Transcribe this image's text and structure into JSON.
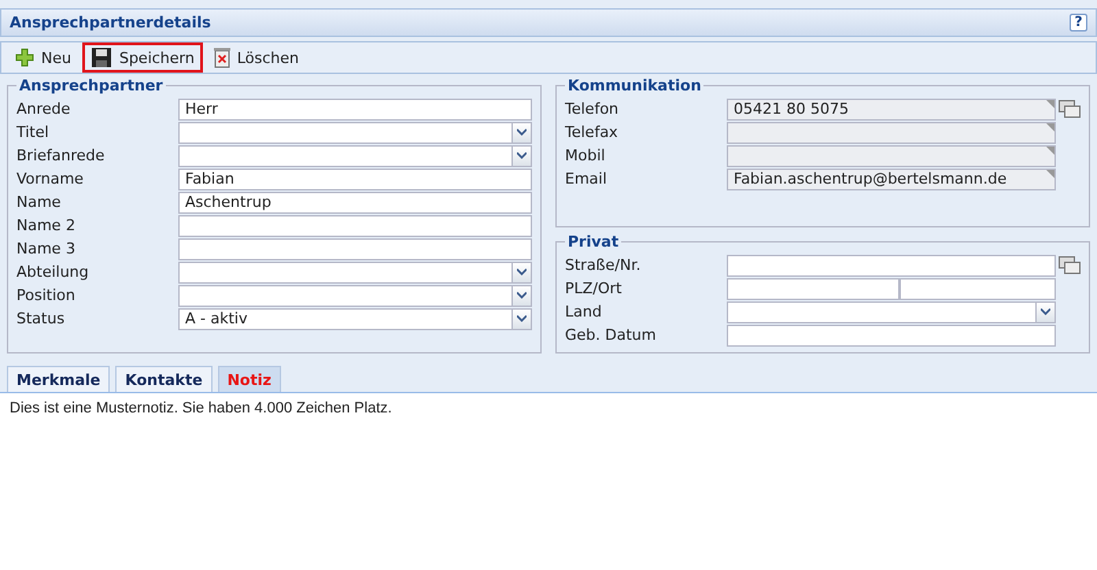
{
  "panel": {
    "title": "Ansprechpartnerdetails",
    "help": "?"
  },
  "toolbar": [
    {
      "kind": "add",
      "label": "Neu",
      "highlighted": false
    },
    {
      "kind": "save",
      "label": "Speichern",
      "highlighted": true
    },
    {
      "kind": "delete",
      "label": "Löschen",
      "highlighted": false
    }
  ],
  "contact": {
    "legend": "Ansprechpartner",
    "fields": [
      {
        "label": "Anrede",
        "kind": "text",
        "value": "Herr"
      },
      {
        "label": "Titel",
        "kind": "select"
      },
      {
        "label": "Briefanrede",
        "kind": "select"
      },
      {
        "label": "Vorname",
        "kind": "text",
        "value": "Fabian"
      },
      {
        "label": "Name",
        "kind": "text",
        "value": "Aschentrup"
      },
      {
        "label": "Name 2",
        "kind": "text"
      },
      {
        "label": "Name 3",
        "kind": "text"
      },
      {
        "label": "Abteilung",
        "kind": "select"
      },
      {
        "label": "Position",
        "kind": "select"
      },
      {
        "label": "Status",
        "kind": "select",
        "value": "A - aktiv"
      }
    ]
  },
  "communication": {
    "legend": "Kommunikation",
    "fields": [
      {
        "label": "Telefon",
        "kind": "readonly",
        "value": "05421 80 5075",
        "side_icon": true
      },
      {
        "label": "Telefax",
        "kind": "readonly",
        "side_icon": false
      },
      {
        "label": "Mobil",
        "kind": "readonly",
        "side_icon": false
      },
      {
        "label": "Email",
        "kind": "readonly",
        "value": "Fabian.aschentrup@bertelsmann.de",
        "side_icon": false
      }
    ]
  },
  "private": {
    "legend": "Privat",
    "fields": [
      {
        "label": "Straße/Nr.",
        "kind": "text",
        "side_icon": true
      },
      {
        "label": "PLZ/Ort",
        "kind": "split",
        "side_icon": false
      },
      {
        "label": "Land",
        "kind": "select",
        "side_icon": false
      },
      {
        "label": "Geb. Datum",
        "kind": "text",
        "side_icon": false
      }
    ]
  },
  "tabs": [
    {
      "label": "Merkmale",
      "selected": false
    },
    {
      "label": "Kontakte",
      "selected": false
    },
    {
      "label": "Notiz",
      "selected": true
    }
  ],
  "note": "Dies ist eine Musternotiz. Sie haben 4.000 Zeichen Platz."
}
